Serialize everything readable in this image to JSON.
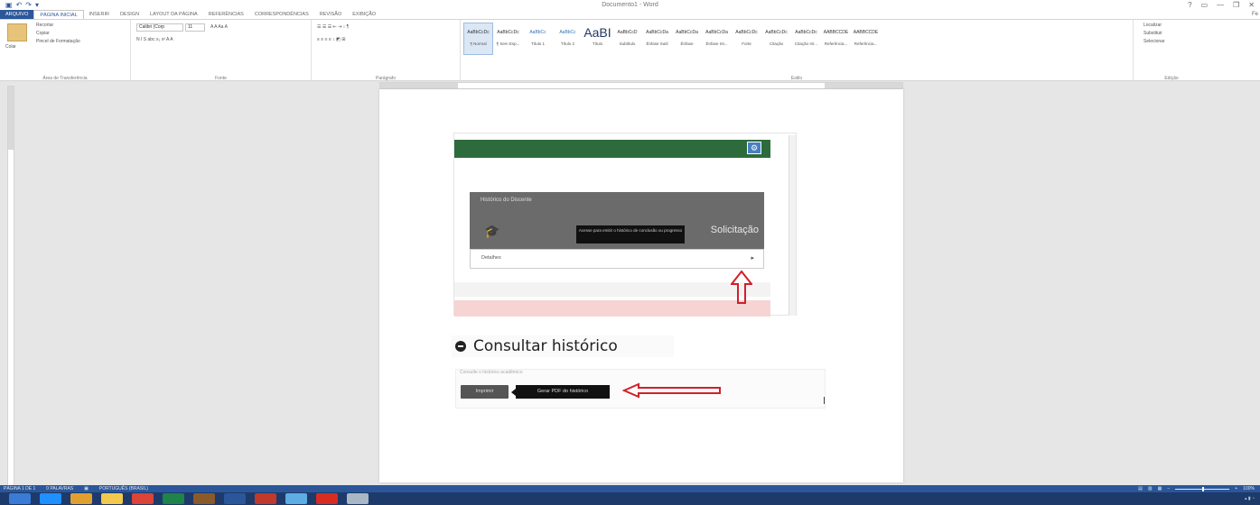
{
  "window": {
    "title": "Documento1 - Word",
    "qat_icons": [
      "save-icon",
      "undo-icon",
      "redo-icon",
      "customize-icon"
    ],
    "controls": [
      "?",
      "▭",
      "—",
      "❐",
      "✕"
    ],
    "user_corner": "Fe"
  },
  "tabs": [
    {
      "label": "ARQUIVO",
      "kind": "file"
    },
    {
      "label": "PÁGINA INICIAL",
      "kind": "active"
    },
    {
      "label": "INSERIR",
      "kind": ""
    },
    {
      "label": "DESIGN",
      "kind": ""
    },
    {
      "label": "LAYOUT DA PÁGINA",
      "kind": ""
    },
    {
      "label": "REFERÊNCIAS",
      "kind": ""
    },
    {
      "label": "CORRESPONDÊNCIAS",
      "kind": ""
    },
    {
      "label": "REVISÃO",
      "kind": ""
    },
    {
      "label": "EXIBIÇÃO",
      "kind": ""
    }
  ],
  "ribbon": {
    "clipboard": {
      "paste": "Colar",
      "cut": "Recortar",
      "copy": "Copiar",
      "format_painter": "Pincel de Formatação",
      "label": "Área de Transferência"
    },
    "font": {
      "font_name": "Calibri (Corp",
      "font_size": "11",
      "label": "Fonte",
      "row1": "A A Aa A",
      "row2": "N I S abc x₂ x²  A  A"
    },
    "paragraph": {
      "label": "Parágrafo",
      "row1": "☰ ☰ ☰  ⇤ ⇥  ↕ ¶",
      "row2": "≡ ≡ ≡ ≡  ↕  ◩  ⊞"
    },
    "styles": {
      "label": "Estilo",
      "items": [
        {
          "sample": "AaBbCcDc",
          "name": "¶ Normal",
          "kind": "sel"
        },
        {
          "sample": "AaBbCcDc",
          "name": "¶ Sem Esp...",
          "kind": ""
        },
        {
          "sample": "AaBbCc",
          "name": "Título 1",
          "kind": "blue"
        },
        {
          "sample": "AaBbCc",
          "name": "Título 2",
          "kind": "blue"
        },
        {
          "sample": "AaBI",
          "name": "Título",
          "kind": "big"
        },
        {
          "sample": "AaBbCcD",
          "name": "Subtítulo",
          "kind": ""
        },
        {
          "sample": "AaBbCcDa",
          "name": "Ênfase Sutil",
          "kind": ""
        },
        {
          "sample": "AaBbCcDa",
          "name": "Ênfase",
          "kind": ""
        },
        {
          "sample": "AaBbCcDa",
          "name": "Ênfase Int...",
          "kind": ""
        },
        {
          "sample": "AaBbCcDc",
          "name": "Forte",
          "kind": ""
        },
        {
          "sample": "AaBbCcDc",
          "name": "Citação",
          "kind": ""
        },
        {
          "sample": "AaBbCcDc",
          "name": "Citação Int...",
          "kind": ""
        },
        {
          "sample": "AABBCCDE",
          "name": "Referência...",
          "kind": ""
        },
        {
          "sample": "AABBCCDE",
          "name": "Referência...",
          "kind": ""
        }
      ]
    },
    "editing": {
      "find": "Localizar",
      "replace": "Substituir",
      "select": "Selecionar",
      "label": "Edição"
    }
  },
  "document": {
    "shot1": {
      "card_title": "Histórico do Discente",
      "tooltip": "Acesse para emitir o histórico de conclusão ou progresso",
      "card_action": "Solicitação",
      "details_label": "Detalhes"
    },
    "heading": "Consultar histórico",
    "shot2": {
      "faint_text": "Consulte o histórico acadêmico",
      "print_button": "Imprimir",
      "tooltip": "Gerar PDF do histórico"
    }
  },
  "statusbar": {
    "page": "PÁGINA 1 DE 1",
    "words": "0 PALAVRAS",
    "lang": "PORTUGUÊS (BRASIL)",
    "zoom": "100%"
  },
  "taskbar": {
    "icons": [
      {
        "name": "start-icon",
        "color": "#3a7bd5"
      },
      {
        "name": "edge-icon",
        "color": "#1e90ff"
      },
      {
        "name": "chrome-icon",
        "color": "#e0a030"
      },
      {
        "name": "folder-icon",
        "color": "#f2c94c"
      },
      {
        "name": "chrome-app-icon",
        "color": "#db4437"
      },
      {
        "name": "app-green-icon",
        "color": "#1e8449"
      },
      {
        "name": "app-brown-icon",
        "color": "#8b5a2b"
      },
      {
        "name": "app-blue-icon",
        "color": "#2b579a"
      },
      {
        "name": "app-red-icon",
        "color": "#c0392b"
      },
      {
        "name": "app-photos-icon",
        "color": "#5dade2"
      },
      {
        "name": "acrobat-icon",
        "color": "#d62d20"
      },
      {
        "name": "app-grey-icon",
        "color": "#aab7c4"
      }
    ]
  }
}
